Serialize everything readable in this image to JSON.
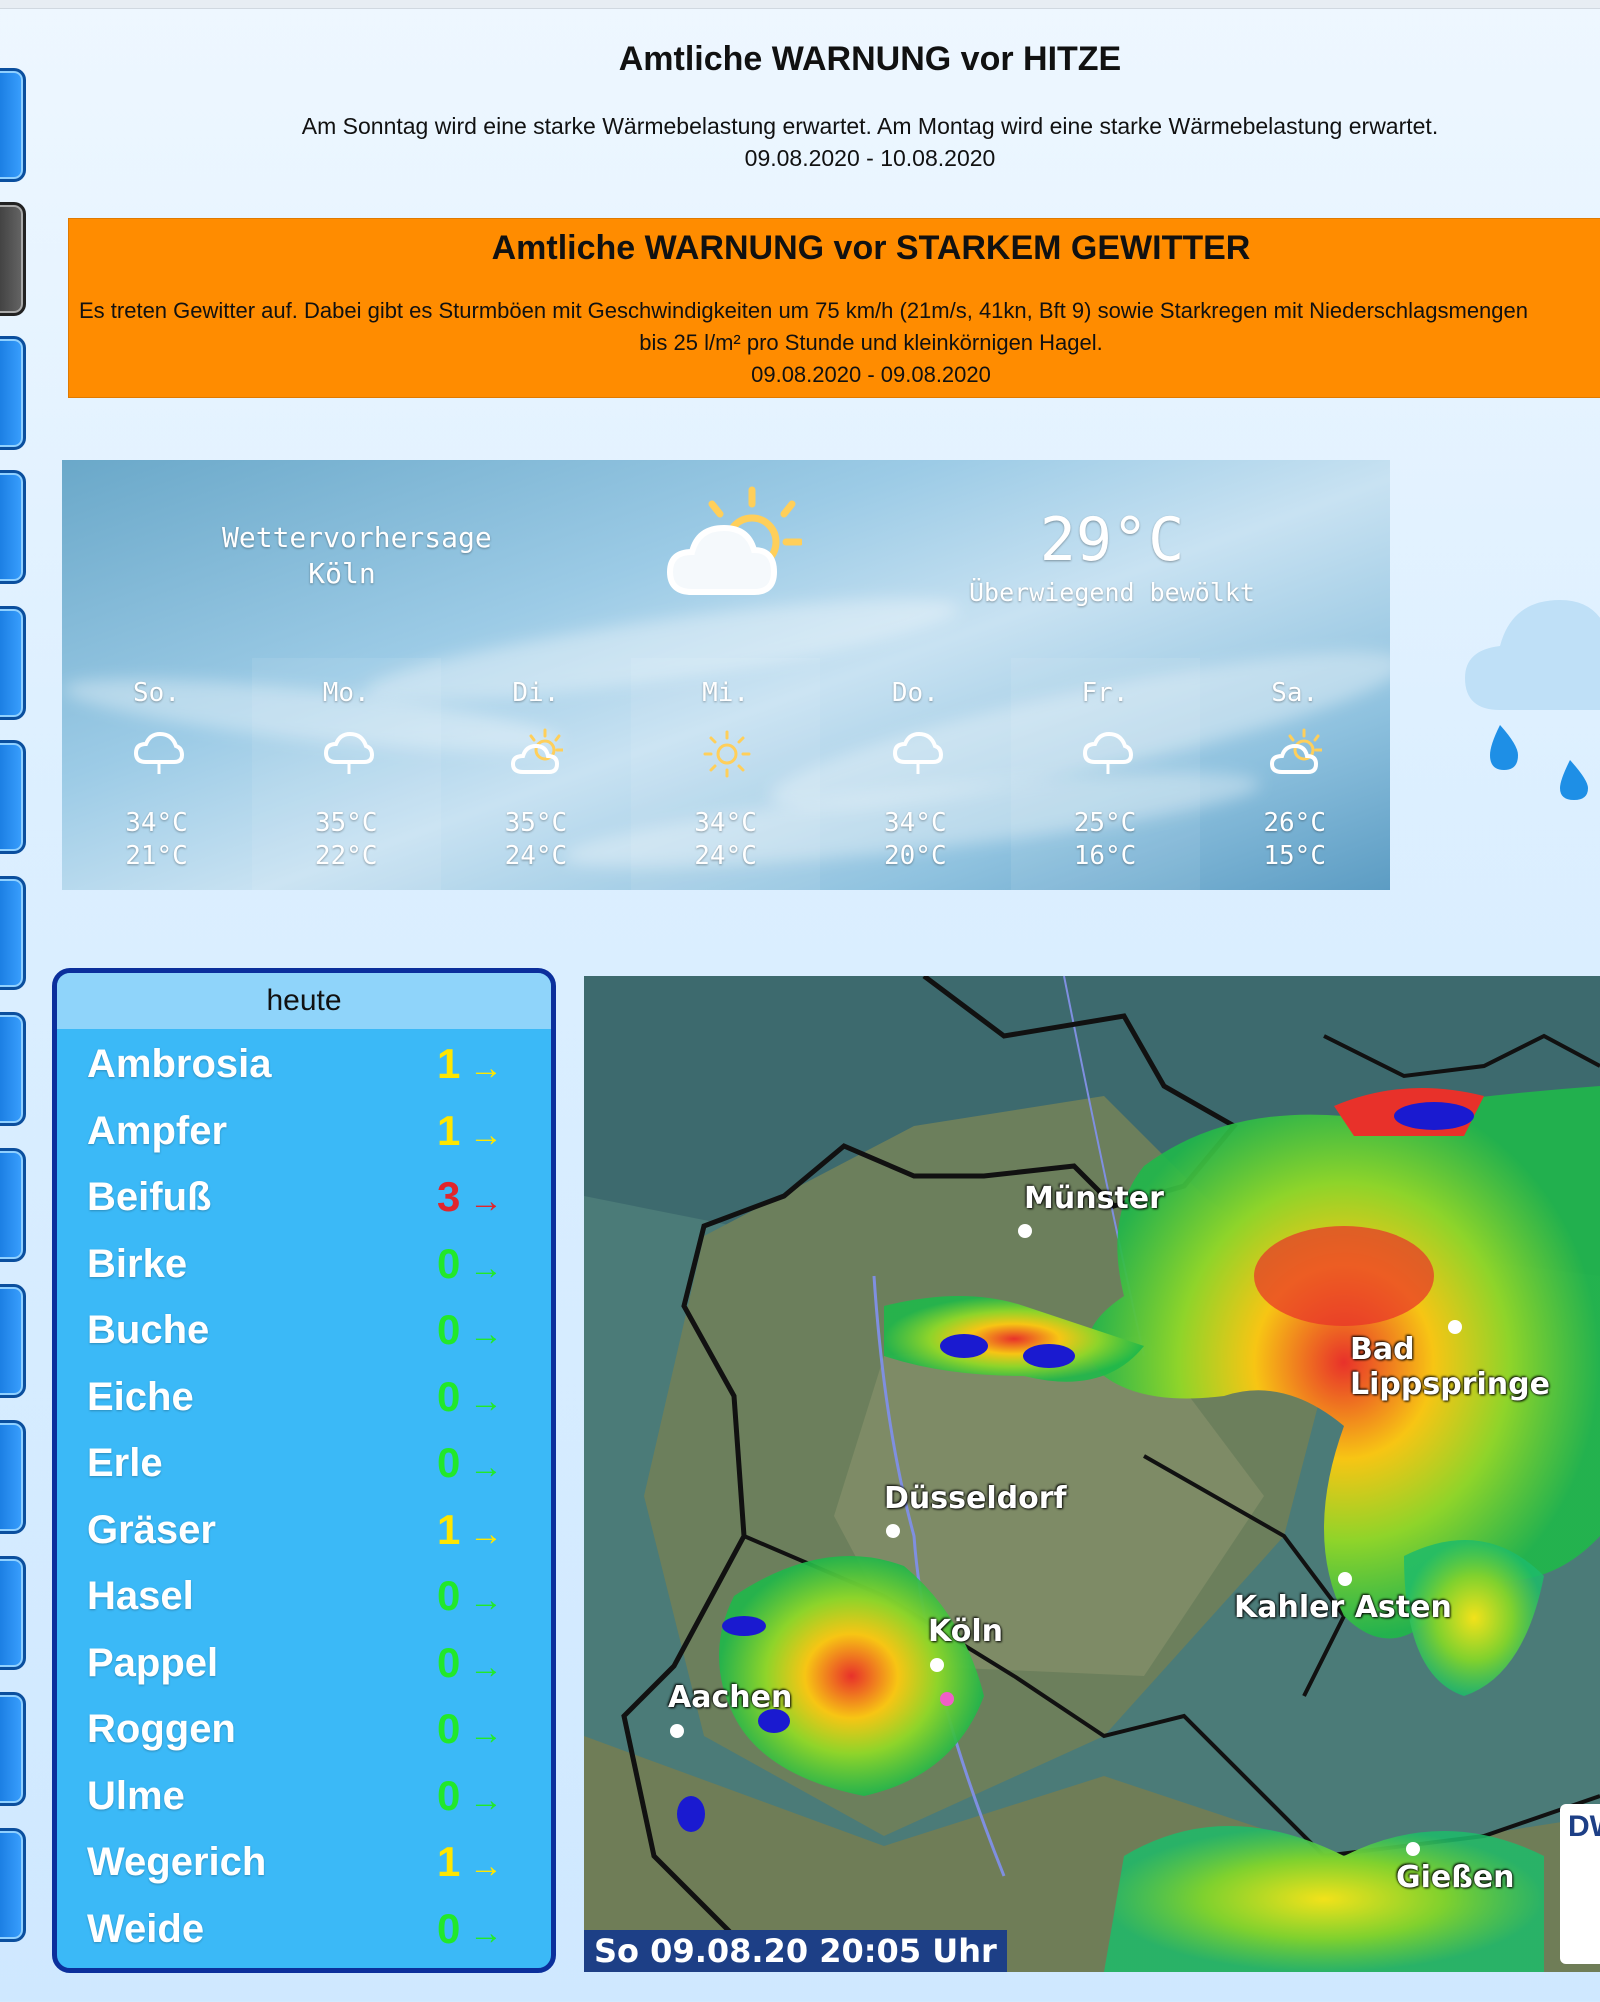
{
  "heat_warning": {
    "title": "Amtliche WARNUNG vor HITZE",
    "text": "Am Sonntag wird eine starke Wärmebelastung erwartet. Am Montag wird eine starke Wärmebelastung erwartet.",
    "period": "09.08.2020 - 10.08.2020"
  },
  "storm_warning": {
    "title": "Amtliche WARNUNG vor STARKEM GEWITTER",
    "text_line1": "Es treten Gewitter auf. Dabei gibt es Sturmböen mit Geschwindigkeiten um 75 km/h (21m/s, 41kn, Bft 9) sowie Starkregen mit Niederschlagsmengen",
    "text_line2": "bis 25 l/m² pro Stunde und kleinkörnigen Hagel.",
    "period": "09.08.2020 - 09.08.2020",
    "color": "#ff8c00"
  },
  "forecast": {
    "title_line1": "Wettervorhersage",
    "title_line2": "Köln",
    "current_temp": "29°C",
    "current_desc": "Überwiegend bewölkt",
    "current_icon": "partly-cloudy-icon",
    "days": [
      {
        "name": "So.",
        "icon": "rain-cloud-icon",
        "max": "34°C",
        "min": "21°C"
      },
      {
        "name": "Mo.",
        "icon": "rain-cloud-icon",
        "max": "35°C",
        "min": "22°C"
      },
      {
        "name": "Di.",
        "icon": "partly-cloudy-icon",
        "max": "35°C",
        "min": "24°C"
      },
      {
        "name": "Mi.",
        "icon": "sun-icon",
        "max": "34°C",
        "min": "24°C"
      },
      {
        "name": "Do.",
        "icon": "rain-cloud-icon",
        "max": "34°C",
        "min": "20°C"
      },
      {
        "name": "Fr.",
        "icon": "rain-cloud-icon",
        "max": "25°C",
        "min": "16°C"
      },
      {
        "name": "Sa.",
        "icon": "partly-cloudy-icon",
        "max": "26°C",
        "min": "15°C"
      }
    ]
  },
  "pollen": {
    "header": "heute",
    "arrow": "→",
    "items": [
      {
        "name": "Ambrosia",
        "value": "1",
        "color": "#ffe600"
      },
      {
        "name": "Ampfer",
        "value": "1",
        "color": "#ffe600"
      },
      {
        "name": "Beifuß",
        "value": "3",
        "color": "#e0262c"
      },
      {
        "name": "Birke",
        "value": "0",
        "color": "#22e82a"
      },
      {
        "name": "Buche",
        "value": "0",
        "color": "#22e82a"
      },
      {
        "name": "Eiche",
        "value": "0",
        "color": "#22e82a"
      },
      {
        "name": "Erle",
        "value": "0",
        "color": "#22e82a"
      },
      {
        "name": "Gräser",
        "value": "1",
        "color": "#ffe600"
      },
      {
        "name": "Hasel",
        "value": "0",
        "color": "#22e82a"
      },
      {
        "name": "Pappel",
        "value": "0",
        "color": "#22e82a"
      },
      {
        "name": "Roggen",
        "value": "0",
        "color": "#22e82a"
      },
      {
        "name": "Ulme",
        "value": "0",
        "color": "#22e82a"
      },
      {
        "name": "Wegerich",
        "value": "1",
        "color": "#ffe600"
      },
      {
        "name": "Weide",
        "value": "0",
        "color": "#22e82a"
      }
    ]
  },
  "radar": {
    "timestamp": "So 09.08.20  20:05 Uhr",
    "logo_text": "DW",
    "cities": {
      "muenster": "Münster",
      "bad_lippspringe": "Bad Lippspringe",
      "duesseldorf": "Düsseldorf",
      "koeln": "Köln",
      "kahler_asten": "Kahler Asten",
      "aachen": "Aachen",
      "giessen": "Gießen"
    }
  }
}
